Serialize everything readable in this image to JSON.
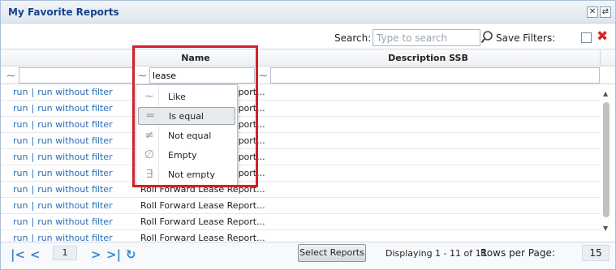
{
  "window": {
    "title": "My Favorite Reports"
  },
  "toolbar": {
    "search_label": "Search:",
    "search_placeholder": "Type to search",
    "save_filters_label": "Save Filters:"
  },
  "columns": {
    "name": "Name",
    "description": "Description SSB"
  },
  "filters": {
    "name_value": "lease",
    "description_value": ""
  },
  "row_links": {
    "run": "run",
    "separator": "|",
    "run_without_filter": "run without filter"
  },
  "rows": [
    {
      "name": "Roll Forward Lease Report..."
    },
    {
      "name": "Roll Forward Lease Report..."
    },
    {
      "name": "Roll Forward Lease Report..."
    },
    {
      "name": "Roll Forward Lease Report..."
    },
    {
      "name": "Roll Forward Lease Report..."
    },
    {
      "name": "Roll Forward Lease Report..."
    },
    {
      "name": "Roll Forward Lease Report..."
    },
    {
      "name": "Roll Forward Lease Report..."
    },
    {
      "name": "Roll Forward Lease Report..."
    },
    {
      "name": "Roll Forward Lease Report..."
    }
  ],
  "filter_menu": {
    "items": [
      {
        "label": "Like",
        "icon": "tilde-icon"
      },
      {
        "label": "Is equal",
        "icon": "equals-icon"
      },
      {
        "label": "Not equal",
        "icon": "not-equal-icon"
      },
      {
        "label": "Empty",
        "icon": "empty-set-icon"
      },
      {
        "label": "Not empty",
        "icon": "exists-icon"
      }
    ],
    "selected": "Is equal"
  },
  "pager": {
    "page": "1",
    "select_reports_label": "Select Reports",
    "displaying": "Displaying 1 - 11 of 11",
    "rows_per_page_label": "Rows per Page:",
    "rows_per_page": "15"
  },
  "colors": {
    "accent": "#15428b",
    "link": "#2a6cb5",
    "highlight": "#d1222b"
  }
}
